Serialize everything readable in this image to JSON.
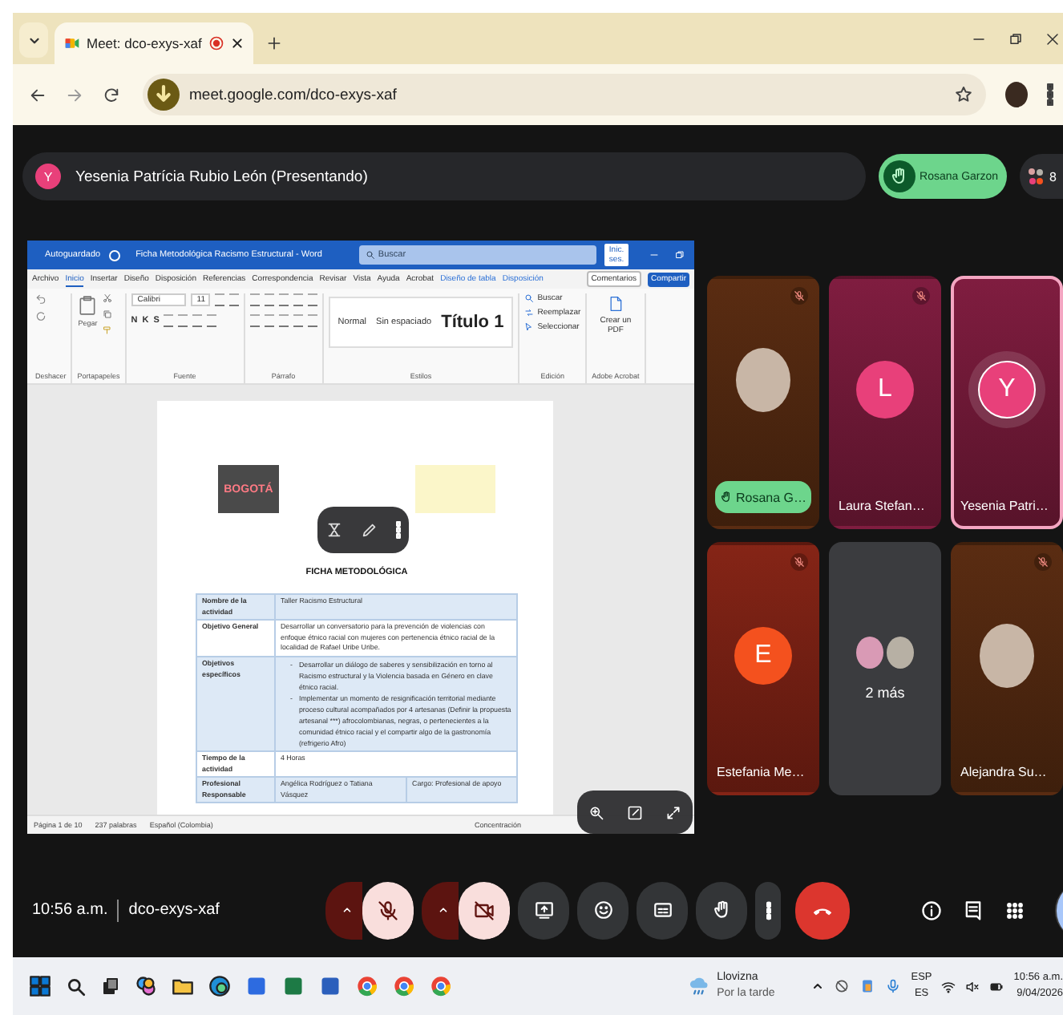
{
  "browser": {
    "tab_title": "Meet: dco-exys-xaf",
    "url": "meet.google.com/dco-exys-xaf"
  },
  "presenter_bar": {
    "initial": "Y",
    "label": "Yesenia Patrícia Rubio León (Presentando)",
    "raised_hand": "Rosana Garzon",
    "participant_count": "8"
  },
  "word": {
    "autosave": "Autoguardado",
    "doc_title": "Ficha Metodológica Racismo Estructural - Word",
    "search": {
      "placeholder": "Buscar"
    },
    "account": "Inic. ses.",
    "menu_tabs": [
      {
        "label": "Archivo",
        "selected": false,
        "kind": "standard"
      },
      {
        "label": "Inicio",
        "selected": true,
        "kind": "standard"
      },
      {
        "label": "Insertar",
        "selected": false,
        "kind": "standard"
      },
      {
        "label": "Diseño",
        "selected": false,
        "kind": "standard"
      },
      {
        "label": "Disposición",
        "selected": false,
        "kind": "standard"
      },
      {
        "label": "Referencias",
        "selected": false,
        "kind": "standard"
      },
      {
        "label": "Correspondencia",
        "selected": false,
        "kind": "standard"
      },
      {
        "label": "Revisar",
        "selected": false,
        "kind": "standard"
      },
      {
        "label": "Vista",
        "selected": false,
        "kind": "standard"
      },
      {
        "label": "Ayuda",
        "selected": false,
        "kind": "standard"
      },
      {
        "label": "Acrobat",
        "selected": false,
        "kind": "standard"
      },
      {
        "label": "Diseño de tabla",
        "selected": false,
        "kind": "contextual"
      },
      {
        "label": "Disposición",
        "selected": false,
        "kind": "contextual"
      }
    ],
    "comments": "Comentarios",
    "share": "Compartir",
    "ribbon": {
      "paste": "Pegar",
      "font": "Calibri",
      "font_size": "11",
      "format_buttons": [
        "N",
        "K",
        "S"
      ],
      "styles": [
        {
          "label": "Normal",
          "kind": "normal"
        },
        {
          "label": "Sin espaciado",
          "kind": "normal"
        },
        {
          "label": "Título 1",
          "kind": "heading"
        }
      ],
      "editing": [
        "Buscar",
        "Reemplazar",
        "Seleccionar"
      ],
      "pdf": "Crear un PDF",
      "group_labels": [
        "Deshacer",
        "Portapapeles",
        "Fuente",
        "Párrafo",
        "Estilos",
        "Edición",
        "Adobe Acrobat"
      ]
    },
    "document": {
      "logo_text": "BOGOTÁ",
      "title": "FICHA METODOLÓGICA",
      "table": [
        {
          "kind": "text",
          "label": "Nombre de la actividad",
          "cells": [
            "Taller Racismo Estructural"
          ]
        },
        {
          "kind": "text",
          "label": "Objetivo General",
          "cells": [
            "Desarrollar un conversatorio para la prevención de violencias con enfoque étnico racial con mujeres con pertenencia étnico racial de la localidad de Rafael Uribe Uribe."
          ]
        },
        {
          "kind": "bullets",
          "label": "Objetivos específicos",
          "marker": "-",
          "cells": [
            "Desarrollar un diálogo de saberes y sensibilización en torno al Racismo estructural y la Violencia basada en Género en clave étnico racial.",
            "Implementar un momento de resignificación territorial mediante proceso cultural acompañados por 4 artesanas (Definir la propuesta artesanal ***) afrocolombianas, negras, o pertenecientes a la comunidad étnico racial y el compartir algo de la gastronomía (refrigerio Afro)"
          ]
        },
        {
          "kind": "text",
          "label": "Tiempo de la actividad",
          "cells": [
            "4 Horas"
          ]
        },
        {
          "kind": "split",
          "label": "Profesional Responsable",
          "cells": [
            "Angélica Rodríguez o Tatiana Vásquez",
            "Cargo: Profesional de apoyo"
          ]
        }
      ]
    },
    "status": [
      "Página 1 de 10",
      "237 palabras",
      "Español (Colombia)"
    ],
    "focus": "Concentración"
  },
  "tiles": [
    {
      "kind": "photo",
      "name": "Rosana G…",
      "muted": true,
      "hand_raised": true,
      "speaking": false
    },
    {
      "kind": "initial",
      "initial": "L",
      "color": "#e8407a",
      "name": "Laura Stefan…",
      "muted": true,
      "hand_raised": false,
      "speaking": false
    },
    {
      "kind": "initial",
      "initial": "Y",
      "color": "#e8407a",
      "name": "Yesenia Patri…",
      "muted": false,
      "hand_raised": false,
      "speaking": true
    },
    {
      "kind": "initial",
      "initial": "E",
      "color": "#f4511e",
      "name": "Estefania Me…",
      "muted": true,
      "hand_raised": false,
      "speaking": false
    },
    {
      "kind": "more",
      "name": "2 más",
      "speaking": false
    },
    {
      "kind": "photo",
      "name": "Alejandra Su…",
      "muted": true,
      "hand_raised": false,
      "speaking": false
    }
  ],
  "controls": {
    "time": "10:56 a.m.",
    "meeting_code": "dco-exys-xaf",
    "mic_muted": true,
    "camera_off": true
  },
  "taskbar": {
    "weather": "Llovizna",
    "weather_detail": "Por la tarde",
    "language": "ESP",
    "layout": "ES",
    "time": "10:56 a.m.",
    "date": "9/04/2026"
  }
}
